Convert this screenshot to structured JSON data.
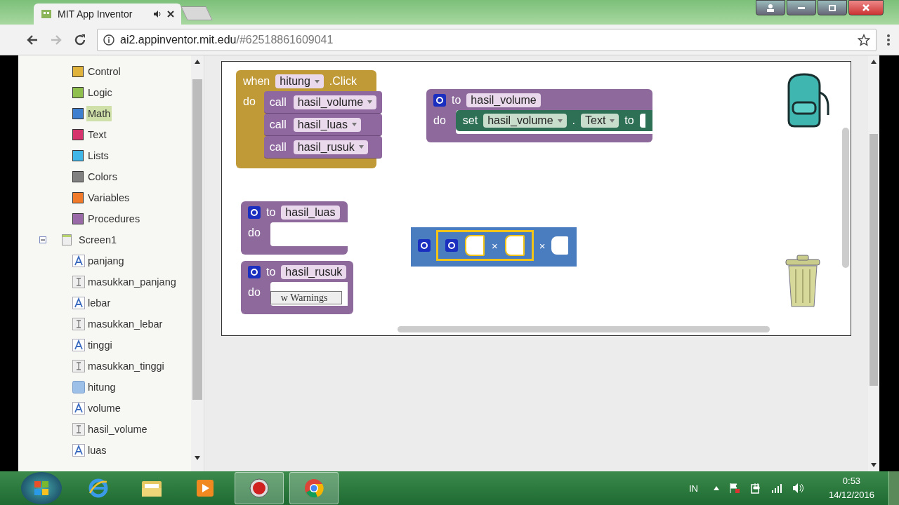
{
  "browser": {
    "tab_title": "MIT App Inventor",
    "address_host": "ai2.appinventor.mit.edu",
    "address_path": "/#62518861609041"
  },
  "sidebar": {
    "builtin": [
      {
        "label": "Control",
        "color": "#e0b43c",
        "selected": false
      },
      {
        "label": "Logic",
        "color": "#8fbf4c",
        "selected": false
      },
      {
        "label": "Math",
        "color": "#3f7fd0",
        "selected": true
      },
      {
        "label": "Text",
        "color": "#d6336c",
        "selected": false
      },
      {
        "label": "Lists",
        "color": "#3fb5e8",
        "selected": false
      },
      {
        "label": "Colors",
        "color": "#808080",
        "selected": false
      },
      {
        "label": "Variables",
        "color": "#f07a2a",
        "selected": false
      },
      {
        "label": "Procedures",
        "color": "#9a6aa8",
        "selected": false
      }
    ],
    "screen": {
      "label": "Screen1",
      "expanded": true,
      "children": [
        {
          "label": "panjang",
          "kind": "label"
        },
        {
          "label": "masukkan_panjang",
          "kind": "textbox"
        },
        {
          "label": "lebar",
          "kind": "label"
        },
        {
          "label": "masukkan_lebar",
          "kind": "textbox"
        },
        {
          "label": "tinggi",
          "kind": "label"
        },
        {
          "label": "masukkan_tinggi",
          "kind": "textbox"
        },
        {
          "label": "hitung",
          "kind": "button"
        },
        {
          "label": "volume",
          "kind": "label"
        },
        {
          "label": "hasil_volume",
          "kind": "textbox"
        },
        {
          "label": "luas",
          "kind": "label"
        }
      ]
    }
  },
  "workspace": {
    "blocks": [
      {
        "kind": "event",
        "keyword": "when",
        "component": "hitung",
        "event": ".Click",
        "do": "do",
        "calls": [
          {
            "keyword": "call",
            "name": "hasil_volume"
          },
          {
            "keyword": "call",
            "name": "hasil_luas"
          },
          {
            "keyword": "call",
            "name": "hasil_rusuk"
          }
        ]
      },
      {
        "kind": "procedure",
        "keyword": "to",
        "name": "hasil_volume",
        "do": "do",
        "setter": {
          "keyword": "set",
          "component": "hasil_volume",
          "separator": ".",
          "property": "Text",
          "to": "to"
        }
      },
      {
        "kind": "procedure",
        "keyword": "to",
        "name": "hasil_luas",
        "do": "do"
      },
      {
        "kind": "procedure",
        "keyword": "to",
        "name": "hasil_rusuk",
        "do": "do",
        "overlap_text": "w Warnings"
      },
      {
        "kind": "math",
        "operators": [
          "×",
          "×"
        ]
      }
    ]
  },
  "taskbar": {
    "language": "IN",
    "time": "0:53",
    "date": "14/12/2016"
  }
}
